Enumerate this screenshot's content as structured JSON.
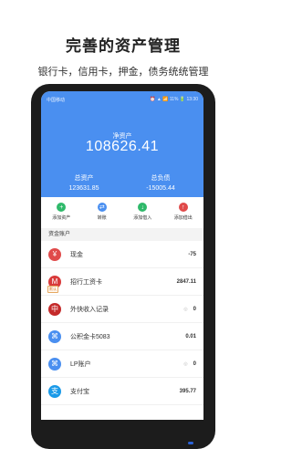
{
  "headline": "完善的资产管理",
  "subline": "银行卡，信用卡，押金，债务统统管理",
  "status_bar": {
    "left": "中国移动",
    "right": "⏰ ▲ 📶 11% 🔋 13:30"
  },
  "summary": {
    "net_label": "净资产",
    "net_value": "108626.41",
    "assets_label": "总资产",
    "assets_value": "123631.85",
    "debts_label": "总负债",
    "debts_value": "-15005.44"
  },
  "actions": [
    {
      "label": "添加资产",
      "icon": "plus-circle-icon",
      "glyph": "+",
      "color": "#2fb96a"
    },
    {
      "label": "转账",
      "icon": "transfer-icon",
      "glyph": "⇄",
      "color": "#4a8ff0"
    },
    {
      "label": "添加借入",
      "icon": "borrow-in-icon",
      "glyph": "↓",
      "color": "#2fb96a"
    },
    {
      "label": "添加借出",
      "icon": "lend-out-icon",
      "glyph": "↑",
      "color": "#e04a4a"
    }
  ],
  "section_title": "资金账户",
  "accounts": [
    {
      "name": "现金",
      "amount": "-75",
      "icon": "cash-icon",
      "glyph": "¥",
      "color": "#e04a4a",
      "tag": "",
      "hint": ""
    },
    {
      "name": "招行工资卡",
      "amount": "2847.11",
      "icon": "cmb-bank-icon",
      "glyph": "M",
      "color": "#d93a3a",
      "tag": "默认",
      "hint": ""
    },
    {
      "name": "外快收入记录",
      "amount": "0",
      "icon": "boc-bank-icon",
      "glyph": "中",
      "color": "#c42a2a",
      "tag": "",
      "hint": "◎"
    },
    {
      "name": "公积金卡5083",
      "amount": "0.01",
      "icon": "fund-icon",
      "glyph": "⌘",
      "color": "#4a8ff0",
      "tag": "",
      "hint": ""
    },
    {
      "name": "LP账户",
      "amount": "0",
      "icon": "lp-account-icon",
      "glyph": "⌘",
      "color": "#4a8ff0",
      "tag": "",
      "hint": "◎"
    },
    {
      "name": "支付宝",
      "amount": "395.77",
      "icon": "alipay-icon",
      "glyph": "支",
      "color": "#1a9ae8",
      "tag": "",
      "hint": ""
    }
  ]
}
